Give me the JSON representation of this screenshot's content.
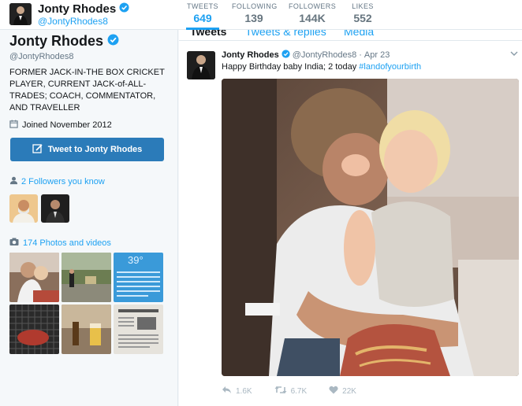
{
  "profile": {
    "name": "Jonty Rhodes",
    "handle": "@JontyRhodes8",
    "bio": "FORMER JACK-IN-THE BOX CRICKET PLAYER, CURRENT JACK-of-ALL-TRADES; COACH, COMMENTATOR, AND TRAVELLER",
    "joined": "Joined November 2012",
    "tweet_to_label": "Tweet to Jonty Rhodes",
    "followers_you_know": "2 Followers you know",
    "photos_label": "174 Photos and videos"
  },
  "stats": [
    {
      "label": "TWEETS",
      "value": "649"
    },
    {
      "label": "FOLLOWING",
      "value": "139"
    },
    {
      "label": "FOLLOWERS",
      "value": "144K"
    },
    {
      "label": "LIKES",
      "value": "552"
    }
  ],
  "tabs": [
    "Tweets",
    "Tweets & replies",
    "Media"
  ],
  "tweet": {
    "name": "Jonty Rhodes",
    "handle": "@JontyRhodes8",
    "dot": "·",
    "date": "Apr 23",
    "text": "Happy Birthday baby India; 2 today ",
    "hashtag": "#landofyourbirth",
    "replies": "1.6K",
    "retweets": "6.7K",
    "likes": "22K"
  },
  "icons": {
    "verified": "verified-badge-icon",
    "calendar": "calendar-icon",
    "compose": "compose-icon",
    "person": "person-icon",
    "camera": "camera-icon",
    "reply": "reply-icon",
    "retweet": "retweet-icon",
    "like": "heart-icon",
    "caret": "chevron-down-icon"
  },
  "colors": {
    "accent": "#1da1f2",
    "button": "#2b7bb9",
    "muted": "#657786"
  }
}
